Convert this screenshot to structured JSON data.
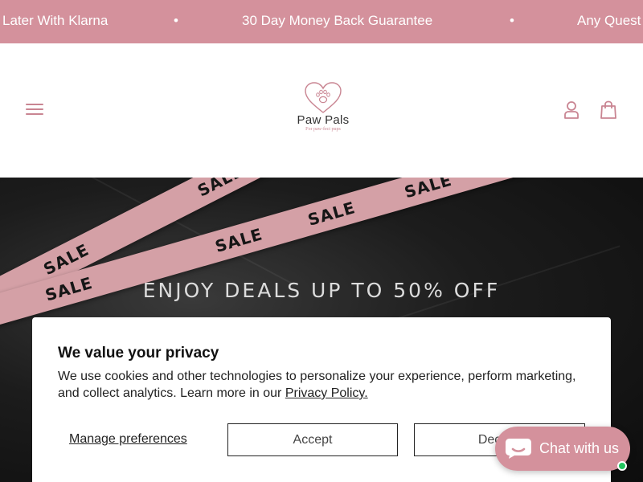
{
  "announcement": {
    "items": [
      "Later With Klarna",
      "30 Day Money Back Guarantee",
      "Any Quest"
    ],
    "separator": "•"
  },
  "header": {
    "logo": {
      "name": "Paw Pals",
      "tagline": "For paw-fect pups"
    },
    "menu_icon": "hamburger-icon",
    "account_icon": "user-icon",
    "cart_icon": "shopping-bag-icon"
  },
  "hero": {
    "headline": "ENJOY DEALS UP TO 50% OFF",
    "tape_word": "SALE"
  },
  "consent": {
    "title": "We value your privacy",
    "body": "We use cookies and other technologies to personalize your experience, perform marketing, and collect analytics. Learn more in our ",
    "policy_link": "Privacy Policy.",
    "manage_label": "Manage preferences",
    "accept_label": "Accept",
    "decline_label": "Decline"
  },
  "chat": {
    "label": "Chat with us",
    "icon": "chat-bubble-icon",
    "status": "online"
  },
  "colors": {
    "brand_pink": "#d4919c",
    "tape_pink": "#d4a0a6",
    "hero_dark": "#111111",
    "online_green": "#22c55e"
  }
}
